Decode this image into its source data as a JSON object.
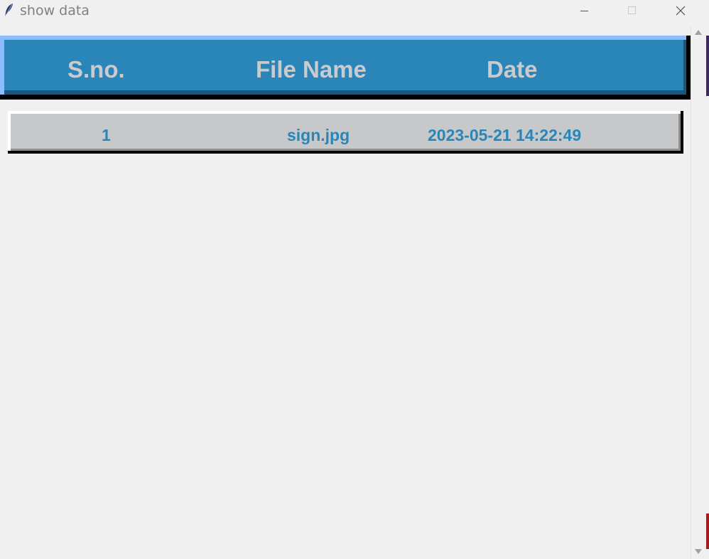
{
  "window": {
    "title": "show data",
    "controls": {
      "minimize": "minimize-icon",
      "maximize": "maximize-icon",
      "close": "close-icon"
    }
  },
  "table": {
    "headers": [
      "S.no.",
      "File Name",
      "Date"
    ],
    "rows": [
      [
        "1",
        "sign.jpg",
        "2023-05-21 14:22:49"
      ]
    ]
  },
  "colors": {
    "header_background": "#2a85b8",
    "header_text": "#c9cbd0",
    "row_background": "#c7c8ca",
    "row_text": "#2a85b8",
    "window_background": "#f0f0f0"
  }
}
